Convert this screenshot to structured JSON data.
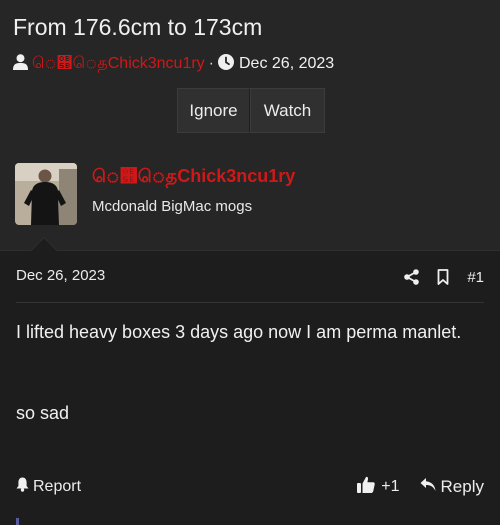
{
  "thread": {
    "title": "From 176.6cm to 173cm",
    "author": "ெ୛ெதChick3ncu1ry",
    "separator": "·",
    "date": "Dec 26, 2023"
  },
  "actions": {
    "ignore_label": "Ignore",
    "watch_label": "Watch"
  },
  "post": {
    "username": "ெ୛ெதChick3ncu1ry",
    "user_title": "Mcdonald BigMac mogs",
    "date": "Dec 26, 2023",
    "number": "#1",
    "body_line1": "I lifted heavy boxes 3 days ago now I am perma manlet.",
    "body_line2": "so sad",
    "report_label": "Report",
    "reaction_count": "+1",
    "reply_label": "Reply"
  },
  "icons": {
    "author": "user-icon",
    "date": "clock-icon",
    "share": "share-icon",
    "bookmark": "bookmark-icon",
    "report": "bell-icon",
    "like": "thumbs-up-icon",
    "reply": "reply-icon"
  },
  "colors": {
    "username": "#d01818",
    "background": "#1d1d1d",
    "header": "#262626"
  }
}
